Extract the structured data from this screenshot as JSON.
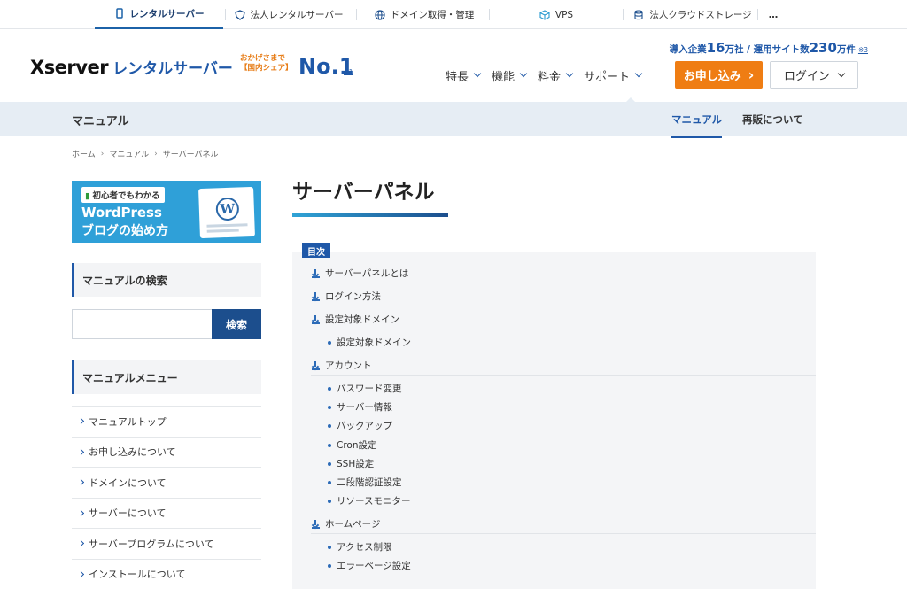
{
  "top_tabs": [
    {
      "label": "レンタルサーバー",
      "icon": "monitor-icon",
      "active": true
    },
    {
      "label": "法人レンタルサーバー",
      "icon": "shield-icon",
      "active": false
    },
    {
      "label": "ドメイン取得・管理",
      "icon": "globe-icon",
      "active": false
    },
    {
      "label": "VPS",
      "icon": "cube-icon",
      "active": false
    },
    {
      "label": "法人クラウドストレージ",
      "icon": "database-icon",
      "active": false
    },
    {
      "label": "…",
      "icon": "",
      "active": false
    }
  ],
  "header": {
    "logo_x": "Xserver",
    "logo_jp": "レンタルサーバー",
    "no1_line1": "おかげさまで",
    "no1_line2": "【国内シェア】",
    "no1_big": "No.1",
    "no1_note": "※1",
    "stats_prefix": "導入企業",
    "stats_num1": "16",
    "stats_mid": "万社 / 運用サイト数",
    "stats_num2": "230",
    "stats_suffix": "万件",
    "stats_note": "※3",
    "nav": [
      "特長",
      "機能",
      "料金",
      "サポート"
    ],
    "apply_label": "お申し込み",
    "apply_arrow": "›",
    "login_label": "ログイン"
  },
  "subnav": {
    "section": "マニュアル",
    "tabs": [
      "マニュアル",
      "再販について"
    ]
  },
  "breadcrumb": [
    "ホーム",
    "マニュアル",
    "サーバーパネル"
  ],
  "banner": {
    "tag": "初心者でもわかる",
    "line1": "WordPress",
    "line2": "ブログの始め方",
    "wp_letter": "W"
  },
  "sidebar": {
    "search_heading": "マニュアルの検索",
    "search_placeholder": "",
    "search_button": "検索",
    "menu_heading": "マニュアルメニュー",
    "menu_items": [
      "マニュアルトップ",
      "お申し込みについて",
      "ドメインについて",
      "サーバーについて",
      "サーバープログラムについて",
      "インストールについて"
    ]
  },
  "main": {
    "title": "サーバーパネル",
    "toc_label": "目次",
    "toc": [
      {
        "level": 1,
        "text": "サーバーパネルとは"
      },
      {
        "level": 1,
        "text": "ログイン方法"
      },
      {
        "level": 1,
        "text": "設定対象ドメイン"
      },
      {
        "level": 2,
        "text": "設定対象ドメイン"
      },
      {
        "level": 1,
        "text": "アカウント"
      },
      {
        "level": 2,
        "text": "パスワード変更"
      },
      {
        "level": 2,
        "text": "サーバー情報"
      },
      {
        "level": 2,
        "text": "バックアップ"
      },
      {
        "level": 2,
        "text": "Cron設定"
      },
      {
        "level": 2,
        "text": "SSH設定"
      },
      {
        "level": 2,
        "text": "二段階認証設定"
      },
      {
        "level": 2,
        "text": "リソースモニター"
      },
      {
        "level": 1,
        "text": "ホームページ"
      },
      {
        "level": 2,
        "text": "アクセス制限"
      },
      {
        "level": 2,
        "text": "エラーページ設定"
      }
    ]
  },
  "colors": {
    "brand": "#1f58a8",
    "accent": "#ef7d13",
    "band": "#e6edf4"
  }
}
